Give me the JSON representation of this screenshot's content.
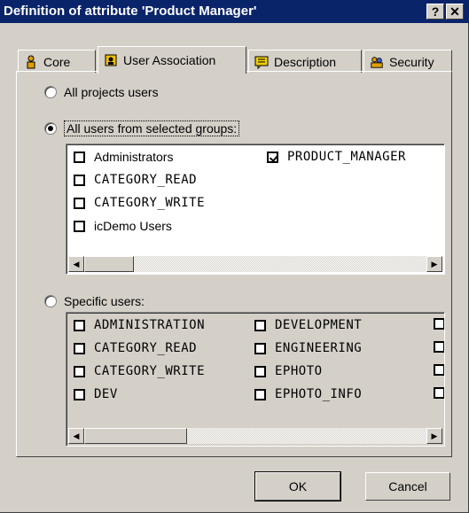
{
  "window": {
    "title": "Definition of attribute 'Product Manager'",
    "help_glyph": "?",
    "close_glyph": "✕"
  },
  "tabs": [
    {
      "label": "Core",
      "icon": "person-icon"
    },
    {
      "label": "User Association",
      "icon": "user-association-icon"
    },
    {
      "label": "Description",
      "icon": "description-icon"
    },
    {
      "label": "Security",
      "icon": "security-icon"
    }
  ],
  "options": {
    "all_projects_users": "All projects users",
    "all_users_from_groups": "All users from selected groups:",
    "specific_users": "Specific users:",
    "selected": "all_users_from_groups"
  },
  "groups": [
    {
      "label": "Administrators",
      "checked": false
    },
    {
      "label": "CATEGORY_READ",
      "checked": false
    },
    {
      "label": "CATEGORY_WRITE",
      "checked": false
    },
    {
      "label": "icDemo Users",
      "checked": false
    },
    {
      "label": "PRODUCT_MANAGER",
      "checked": true
    }
  ],
  "users": [
    {
      "label": "ADMINISTRATION",
      "checked": false
    },
    {
      "label": "CATEGORY_READ",
      "checked": false
    },
    {
      "label": "CATEGORY_WRITE",
      "checked": false
    },
    {
      "label": "DEV",
      "checked": false
    },
    {
      "label": "DEVELOPMENT",
      "checked": false
    },
    {
      "label": "ENGINEERING",
      "checked": false
    },
    {
      "label": "EPHOTO",
      "checked": false
    },
    {
      "label": "EPHOTO_INFO",
      "checked": false
    }
  ],
  "buttons": {
    "ok": "OK",
    "cancel": "Cancel"
  },
  "colors": {
    "titlebar": "#0a246a",
    "face": "#d4d0c8"
  }
}
